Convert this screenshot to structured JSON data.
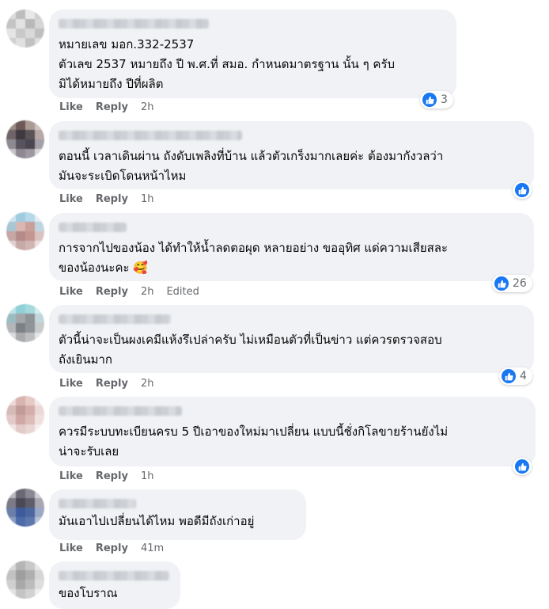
{
  "actions": {
    "like": "Like",
    "reply": "Reply"
  },
  "comments": [
    {
      "text": "หมายเลข มอก.332-2537\nตัวเลข 2537 หมายถึง ปี พ.ศ.ที่ สมอ. กำหนดมาตรฐาน นั้น ๆ ครับ\nมิได้หมายถึง ปีที่ผลิต",
      "time": "2h",
      "reaction_count": "3"
    },
    {
      "text": "ตอนนี้ เวลาเดินผ่าน ถังดับเพลิงที่บ้าน แล้วตัวเกร็งมากเลยค่ะ ต้องมากังวลว่า\nมันจะระเบิดโดนหน้าไหม",
      "time": "1h",
      "reaction_count": ""
    },
    {
      "text": "การจากไปของน้อง ได้ทำให้น้ำลดตอผุด หลายอย่าง ขออุทิศ แด่ความเสียสละ\nของน้องนะคะ 🥰",
      "time": "2h",
      "edited": "Edited",
      "reaction_count": "26"
    },
    {
      "text": "ตัวนี้น่าจะเป็นผงเคมีแห้งรึเปล่าครับ ไม่เหมือนตัวที่เป็นข่าว แต่ควรตรวจสอบ\nถังเยินมาก",
      "time": "2h",
      "reaction_count": "4"
    },
    {
      "text": "ควรมีระบบทะเบียนครบ 5 ปีเอาของใหม่มาเปลี่ยน แบบนี้ชั่งกิโลขายร้านยังไม่\nน่าจะรับเลย",
      "time": "1h",
      "reaction_count": ""
    },
    {
      "text": "มันเอาไปเปลี่ยนได้ไหม พอดีมีถังเก่าอยู่",
      "time": "41m",
      "reaction_count": ""
    },
    {
      "text": "ของโบราณ",
      "time": "",
      "reaction_count": ""
    }
  ]
}
